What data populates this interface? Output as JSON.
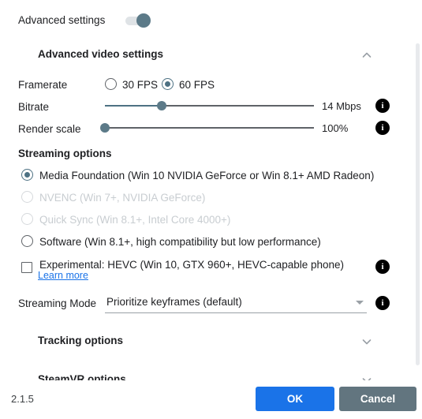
{
  "app": {
    "version": "2.1.5"
  },
  "advanced_settings": {
    "label": "Advanced settings",
    "toggle_state": "on"
  },
  "sections": {
    "video": {
      "title": "Advanced video settings",
      "expanded": true,
      "chevron": "chevron-up-icon"
    },
    "tracking": {
      "title": "Tracking options",
      "expanded": false,
      "chevron": "chevron-down-icon"
    },
    "steamvr": {
      "title": "SteamVR options",
      "expanded": false,
      "chevron": "chevron-down-icon"
    }
  },
  "framerate": {
    "label": "Framerate",
    "options": [
      {
        "label": "30 FPS",
        "selected": false
      },
      {
        "label": "60 FPS",
        "selected": true
      }
    ]
  },
  "bitrate": {
    "label": "Bitrate",
    "value_text": "14 Mbps",
    "percent": 27,
    "info": "info-icon"
  },
  "render_scale": {
    "label": "Render scale",
    "value_text": "100%",
    "percent": 0,
    "info": "info-icon"
  },
  "streaming_options": {
    "label": "Streaming options",
    "options": [
      {
        "label": "Media Foundation (Win 10 NVIDIA GeForce or Win 8.1+ AMD Radeon)",
        "selected": true,
        "disabled": false
      },
      {
        "label": "NVENC (Win 7+, NVIDIA GeForce)",
        "selected": false,
        "disabled": true
      },
      {
        "label": "Quick Sync (Win 8.1+, Intel Core 4000+)",
        "selected": false,
        "disabled": true
      },
      {
        "label": "Software (Win 8.1+, high compatibility but low performance)",
        "selected": false,
        "disabled": false
      }
    ]
  },
  "hevc": {
    "label": "Experimental: HEVC (Win 10, GTX 960+, HEVC-capable phone)",
    "link_label": "Learn more",
    "checked": false,
    "info": "info-icon"
  },
  "streaming_mode": {
    "label": "Streaming Mode",
    "selected": "Prioritize keyframes (default)",
    "info": "info-icon"
  },
  "footer": {
    "ok_label": "OK",
    "cancel_label": "Cancel"
  },
  "colors": {
    "accent_blue": "#1a73e8",
    "slate": "#5c7a88",
    "cancel_gray": "#62757f",
    "text": "#202124",
    "disabled_text": "#c8cdd1"
  }
}
